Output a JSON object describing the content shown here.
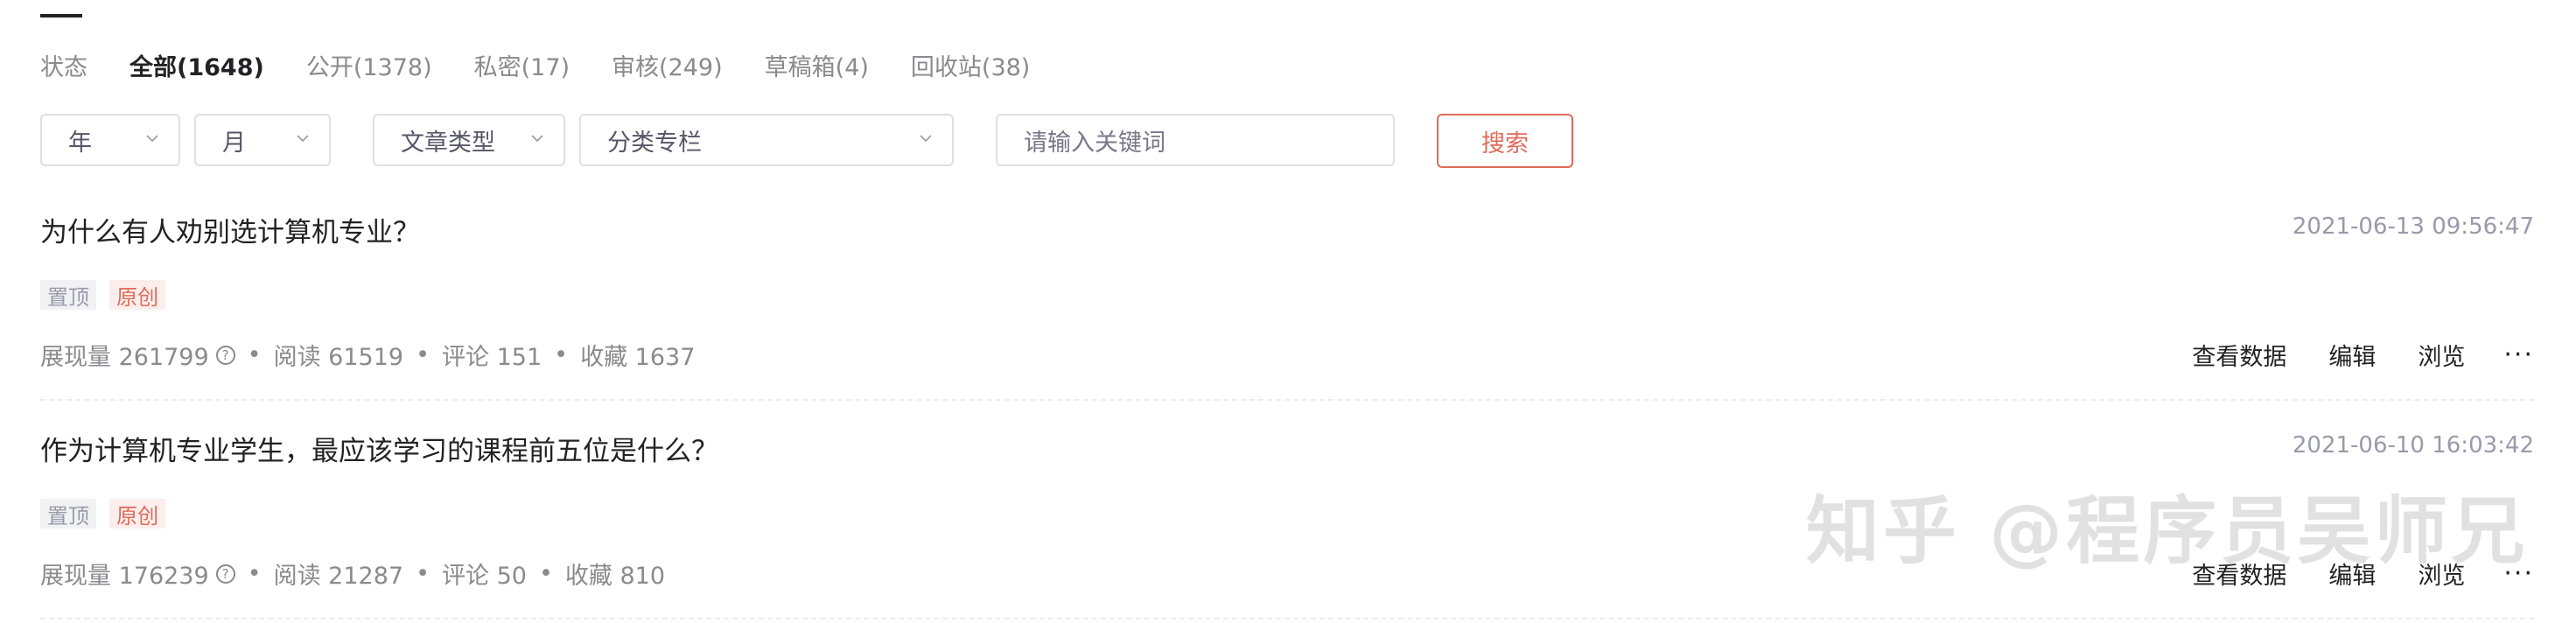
{
  "status_tabs": [
    {
      "label": "状态"
    },
    {
      "label": "全部(1648)"
    },
    {
      "label": "公开(1378)"
    },
    {
      "label": "私密(17)"
    },
    {
      "label": "审核(249)"
    },
    {
      "label": "草稿箱(4)"
    },
    {
      "label": "回收站(38)"
    }
  ],
  "filters": {
    "year": "年",
    "month": "月",
    "article_type": "文章类型",
    "category": "分类专栏",
    "keyword_placeholder": "请输入关键词",
    "search_label": "搜索"
  },
  "articles": [
    {
      "title": "为什么有人劝别选计算机专业？",
      "date": "2021-06-13 09:56:47",
      "tags": {
        "pin": "置顶",
        "original": "原创"
      },
      "stats": {
        "impressions": "展现量 261799",
        "reads": "阅读 61519",
        "comments": "评论 151",
        "favorites": "收藏 1637"
      },
      "actions": {
        "view_data": "查看数据",
        "edit": "编辑",
        "browse": "浏览",
        "more": "···"
      }
    },
    {
      "title": "作为计算机专业学生，最应该学习的课程前五位是什么？",
      "date": "2021-06-10 16:03:42",
      "tags": {
        "pin": "置顶",
        "original": "原创"
      },
      "stats": {
        "impressions": "展现量 176239",
        "reads": "阅读 21287",
        "comments": "评论 50",
        "favorites": "收藏 810"
      },
      "actions": {
        "view_data": "查看数据",
        "edit": "编辑",
        "browse": "浏览",
        "more": "···"
      }
    }
  ],
  "watermark": "知乎 @程序员吴师兄",
  "colors": {
    "accent": "#e06b5a",
    "text": "#222226",
    "muted": "#8a8a8f"
  }
}
